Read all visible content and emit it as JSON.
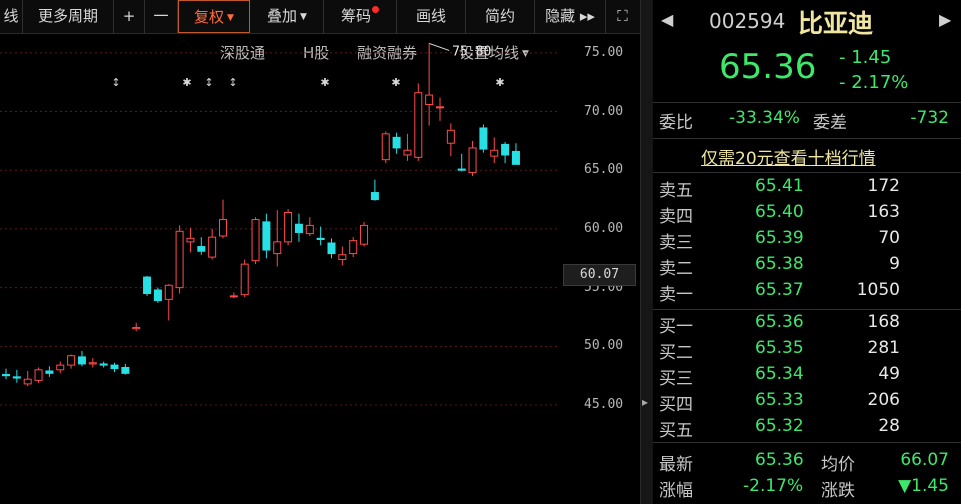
{
  "toolbar": {
    "items": [
      "线",
      "更多周期",
      "+",
      "一",
      "复权",
      "叠加",
      "筹码",
      "画线",
      "简约",
      "隐藏 ▸▸",
      "⛶"
    ]
  },
  "subbar": {
    "items": [
      "深股通",
      "H股",
      "融资融券",
      "设置均线"
    ]
  },
  "chart_data": {
    "type": "candlestick",
    "ylim": [
      43,
      79
    ],
    "yticks": [
      "75.00",
      "70.00",
      "65.00",
      "60.00",
      "55.00",
      "50.00",
      "45.00"
    ],
    "price_label": "60.07",
    "peak_label": "75.80",
    "candles": [
      [
        47.6,
        48.1,
        47.2,
        47.5
      ],
      [
        47.4,
        48.0,
        46.9,
        47.3
      ],
      [
        46.8,
        47.9,
        46.6,
        47.2
      ],
      [
        47.1,
        48.2,
        46.9,
        48.0
      ],
      [
        47.9,
        48.3,
        47.4,
        47.7
      ],
      [
        48.0,
        48.7,
        47.7,
        48.4
      ],
      [
        48.4,
        49.3,
        48.1,
        49.2
      ],
      [
        49.1,
        49.6,
        48.3,
        48.5
      ],
      [
        48.5,
        49.0,
        48.2,
        48.6
      ],
      [
        48.5,
        48.7,
        48.2,
        48.4
      ],
      [
        48.4,
        48.6,
        47.8,
        48.1
      ],
      [
        48.2,
        48.5,
        47.6,
        47.7
      ],
      [
        51.5,
        52.0,
        51.3,
        51.6
      ],
      [
        55.9,
        56.0,
        54.3,
        54.5
      ],
      [
        54.8,
        55.0,
        53.7,
        53.9
      ],
      [
        54.0,
        55.3,
        52.2,
        55.2
      ],
      [
        55.0,
        60.3,
        54.5,
        59.8
      ],
      [
        58.9,
        60.1,
        58.0,
        59.2
      ],
      [
        58.5,
        59.3,
        57.8,
        58.1
      ],
      [
        57.6,
        60.0,
        57.4,
        59.3
      ],
      [
        59.4,
        62.5,
        59.2,
        60.8
      ],
      [
        54.3,
        54.6,
        54.1,
        54.3
      ],
      [
        54.4,
        57.4,
        54.2,
        57.0
      ],
      [
        57.3,
        61.0,
        57.0,
        60.8
      ],
      [
        60.6,
        61.3,
        57.5,
        58.2
      ],
      [
        57.9,
        61.6,
        56.8,
        58.9
      ],
      [
        58.9,
        61.7,
        58.6,
        61.4
      ],
      [
        60.4,
        61.3,
        58.9,
        59.7
      ],
      [
        59.6,
        61.0,
        59.4,
        60.3
      ],
      [
        59.2,
        60.2,
        58.6,
        59.1
      ],
      [
        58.8,
        59.2,
        57.5,
        57.9
      ],
      [
        57.4,
        58.5,
        56.9,
        57.8
      ],
      [
        57.9,
        59.3,
        57.6,
        59.0
      ],
      [
        58.7,
        60.6,
        58.5,
        60.3
      ],
      [
        63.1,
        64.2,
        62.4,
        62.5
      ],
      [
        65.9,
        68.3,
        65.6,
        68.1
      ],
      [
        67.8,
        68.2,
        66.4,
        66.9
      ],
      [
        66.3,
        68.1,
        65.8,
        66.7
      ],
      [
        66.1,
        72.4,
        65.8,
        71.6
      ],
      [
        70.6,
        75.8,
        68.8,
        71.4
      ],
      [
        70.4,
        71.2,
        69.2,
        70.4
      ],
      [
        67.3,
        69.0,
        66.2,
        68.4
      ],
      [
        65.1,
        66.4,
        64.9,
        65.0
      ],
      [
        64.8,
        67.5,
        64.5,
        66.9
      ],
      [
        68.6,
        68.9,
        66.5,
        66.8
      ],
      [
        66.2,
        67.8,
        65.6,
        66.7
      ],
      [
        67.2,
        67.4,
        65.6,
        66.3
      ],
      [
        66.6,
        67.3,
        65.7,
        65.5
      ]
    ]
  },
  "panel": {
    "code": "002594",
    "name": "比亚迪",
    "price": "65.36",
    "change": "- 1.45",
    "pct": "- 2.17%",
    "weibi_label": "委比",
    "weibi": "-33.34%",
    "weicha_label": "委差",
    "weicha": "-732",
    "ten_level_link": "仅需20元查看十档行情",
    "sells": [
      {
        "label": "卖五",
        "price": "65.41",
        "vol": "172"
      },
      {
        "label": "卖四",
        "price": "65.40",
        "vol": "163"
      },
      {
        "label": "卖三",
        "price": "65.39",
        "vol": "70"
      },
      {
        "label": "卖二",
        "price": "65.38",
        "vol": "9"
      },
      {
        "label": "卖一",
        "price": "65.37",
        "vol": "1050"
      }
    ],
    "buys": [
      {
        "label": "买一",
        "price": "65.36",
        "vol": "168"
      },
      {
        "label": "买二",
        "price": "65.35",
        "vol": "281"
      },
      {
        "label": "买三",
        "price": "65.34",
        "vol": "49"
      },
      {
        "label": "买四",
        "price": "65.33",
        "vol": "206"
      },
      {
        "label": "买五",
        "price": "65.32",
        "vol": "28"
      }
    ],
    "latest_label": "最新",
    "latest": "65.36",
    "avg_label": "均价",
    "avg": "66.07",
    "zf_label": "涨幅",
    "zf": "-2.17%",
    "zd_label": "涨跌",
    "zd": "▼1.45"
  },
  "colors": {
    "up": "#ff4a4a",
    "down": "#27e0e6",
    "green": "#3ee86b",
    "orange": "#ff6a3a"
  }
}
